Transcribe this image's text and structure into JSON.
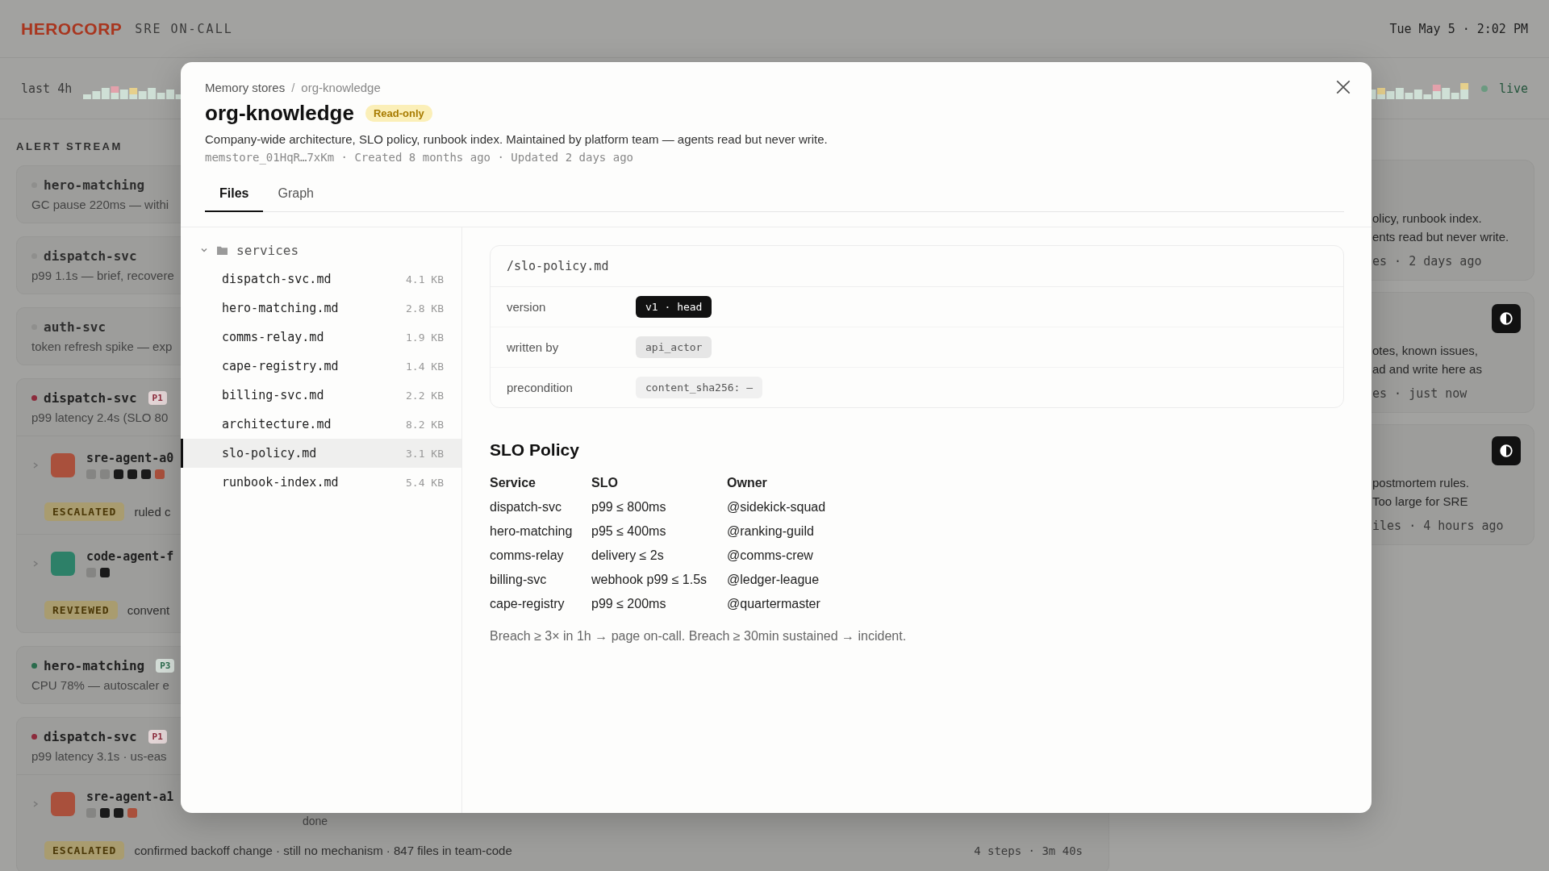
{
  "header": {
    "logo": "HEROCORP",
    "subtitle": "SRE ON-CALL",
    "clock": "Tue May 5 · 2:02 PM"
  },
  "timeline": {
    "range": "last 4h",
    "status": "live"
  },
  "alert_stream": {
    "title": "ALERT STREAM",
    "alerts": [
      {
        "kind": "quiet",
        "service": "hero-matching",
        "color": "#8f8f8d",
        "summary": "GC pause 220ms — withi"
      },
      {
        "kind": "quiet",
        "service": "dispatch-svc",
        "color": "#8f8f8d",
        "summary": "p99 1.1s — brief, recovere"
      },
      {
        "kind": "quiet",
        "service": "auth-svc",
        "color": "#8f8f8d",
        "summary": "token refresh spike — exp"
      },
      {
        "kind": "active",
        "service": "dispatch-svc",
        "color": "#8c2b3c",
        "priority": "P1",
        "summary": "p99 latency 2.4s (SLO 80",
        "agents": [
          {
            "name": "sre-agent-a0",
            "color": "#a9503c",
            "steps": [
              {
                "color": "#858583"
              },
              {
                "color": "#858583"
              },
              {
                "color": "#1a1a1a"
              },
              {
                "color": "#1a1a1a"
              },
              {
                "color": "#1a1a1a"
              },
              {
                "color": "#a9503c"
              }
            ],
            "verdict": "ESCALATED",
            "note": "ruled c"
          },
          {
            "name": "code-agent-f",
            "color": "#2d8068",
            "steps": [
              {
                "color": "#858583"
              },
              {
                "color": "#1a1a1a"
              }
            ],
            "verdict": "REVIEWED",
            "note": "convent"
          }
        ]
      },
      {
        "kind": "active",
        "service": "hero-matching",
        "color": "#2a6b4c",
        "priority": "P3",
        "summary": "CPU 78% — autoscaler e"
      },
      {
        "kind": "active",
        "service": "dispatch-svc",
        "color": "#8c2b3c",
        "priority": "P1",
        "summary": "p99 latency 3.1s · us-eas",
        "agents": [
          {
            "name": "sre-agent-a1",
            "color": "#a9503c",
            "status": "done",
            "steps": [
              {
                "color": "#858583"
              },
              {
                "color": "#1a1a1a"
              },
              {
                "color": "#1a1a1a"
              },
              {
                "color": "#a9503c"
              }
            ],
            "verdict": "ESCALATED",
            "note": "confirmed backoff change · still no mechanism · 847 files in team-code",
            "stats": "4 steps · 3m 40s"
          }
        ]
      }
    ]
  },
  "memory_cards": [
    {
      "kind": "shared",
      "lines": [
        "olicy, runbook index.",
        "ents read but never write."
      ],
      "meta": "es · 2 days ago"
    },
    {
      "kind": "agent",
      "lines": [
        "otes, known issues,",
        "ad and write here as"
      ],
      "meta": "es · just now"
    },
    {
      "kind": "agent",
      "lines": [
        "postmortem rules.",
        "Too large for SRE"
      ],
      "meta": "iles · 4 hours ago"
    }
  ],
  "modal": {
    "breadcrumb": [
      "Memory stores",
      "org-knowledge"
    ],
    "breadcrumb_separator": "/",
    "title": "org-knowledge",
    "badge": "Read-only",
    "description": "Company-wide architecture, SLO policy, runbook index. Maintained by platform team — agents read but never write.",
    "meta": "memstore_01HqR…7xKm · Created 8 months ago · Updated 2 days ago",
    "tabs": [
      {
        "label": "Files",
        "selected": true
      },
      {
        "label": "Graph",
        "selected": false
      }
    ],
    "tree": {
      "folder": "services",
      "expanded": true,
      "files": [
        {
          "name": "dispatch-svc.md",
          "size": "4.1 KB",
          "selected": false
        },
        {
          "name": "hero-matching.md",
          "size": "2.8 KB",
          "selected": false
        },
        {
          "name": "comms-relay.md",
          "size": "1.9 KB",
          "selected": false
        },
        {
          "name": "cape-registry.md",
          "size": "1.4 KB",
          "selected": false
        },
        {
          "name": "billing-svc.md",
          "size": "2.2 KB",
          "selected": false
        },
        {
          "name": "architecture.md",
          "size": "8.2 KB",
          "selected": false
        },
        {
          "name": "slo-policy.md",
          "size": "3.1 KB",
          "selected": true
        },
        {
          "name": "runbook-index.md",
          "size": "5.4 KB",
          "selected": false
        }
      ]
    },
    "file": {
      "path": "/slo-policy.md",
      "properties": [
        {
          "label": "version",
          "value": "v1 · head",
          "kind": "version"
        },
        {
          "label": "written by",
          "value": "api_actor",
          "kind": "actor"
        },
        {
          "label": "precondition",
          "value": "content_sha256: —",
          "kind": "hash"
        }
      ]
    },
    "doc": {
      "heading": "SLO Policy",
      "columns": [
        "Service",
        "SLO",
        "Owner"
      ],
      "rows": [
        [
          "dispatch-svc",
          "p99 ≤ 800ms",
          "@sidekick-squad"
        ],
        [
          "hero-matching",
          "p95 ≤ 400ms",
          "@ranking-guild"
        ],
        [
          "comms-relay",
          "delivery ≤ 2s",
          "@comms-crew"
        ],
        [
          "billing-svc",
          "webhook p99 ≤ 1.5s",
          "@ledger-league"
        ],
        [
          "cape-registry",
          "p99 ≤ 200ms",
          "@quartermaster"
        ]
      ],
      "note": "Breach ≥ 3× in 1h → page on-call. Breach ≥ 30min sustained → incident."
    }
  }
}
